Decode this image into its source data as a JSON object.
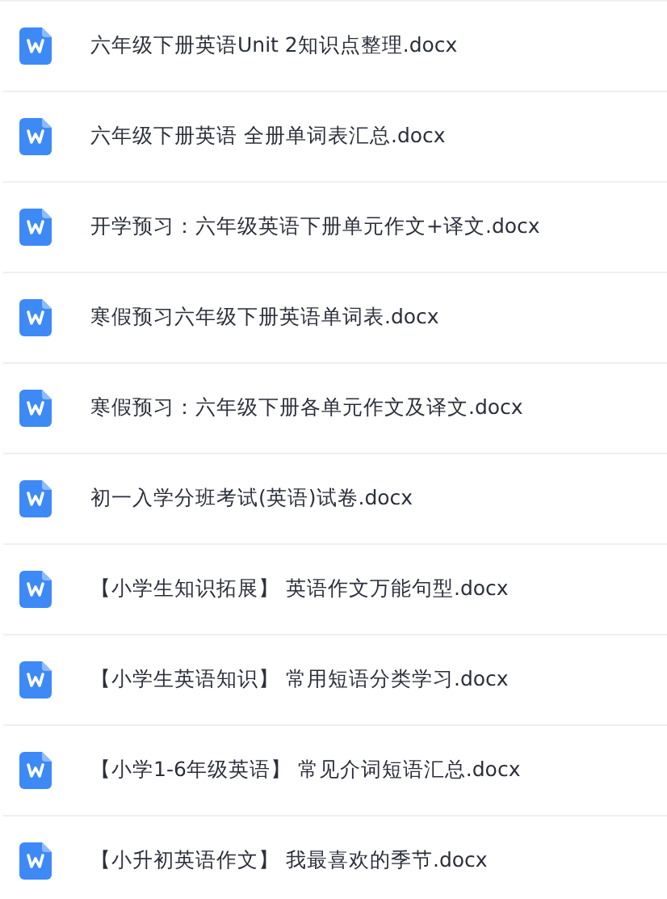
{
  "files": [
    {
      "name": "六年级下册英语Unit 2知识点整理.docx"
    },
    {
      "name": "六年级下册英语 全册单词表汇总.docx"
    },
    {
      "name": "开学预习：六年级英语下册单元作文+译文.docx"
    },
    {
      "name": "寒假预习六年级下册英语单词表.docx"
    },
    {
      "name": "寒假预习：六年级下册各单元作文及译文.docx"
    },
    {
      "name": "初一入学分班考试(英语)试卷.docx"
    },
    {
      "name": "【小学生知识拓展】 英语作文万能句型.docx"
    },
    {
      "name": "【小学生英语知识】 常用短语分类学习.docx"
    },
    {
      "name": "【小学1-6年级英语】 常见介词短语汇总.docx"
    },
    {
      "name": "【小升初英语作文】 我最喜欢的季节.docx"
    }
  ]
}
